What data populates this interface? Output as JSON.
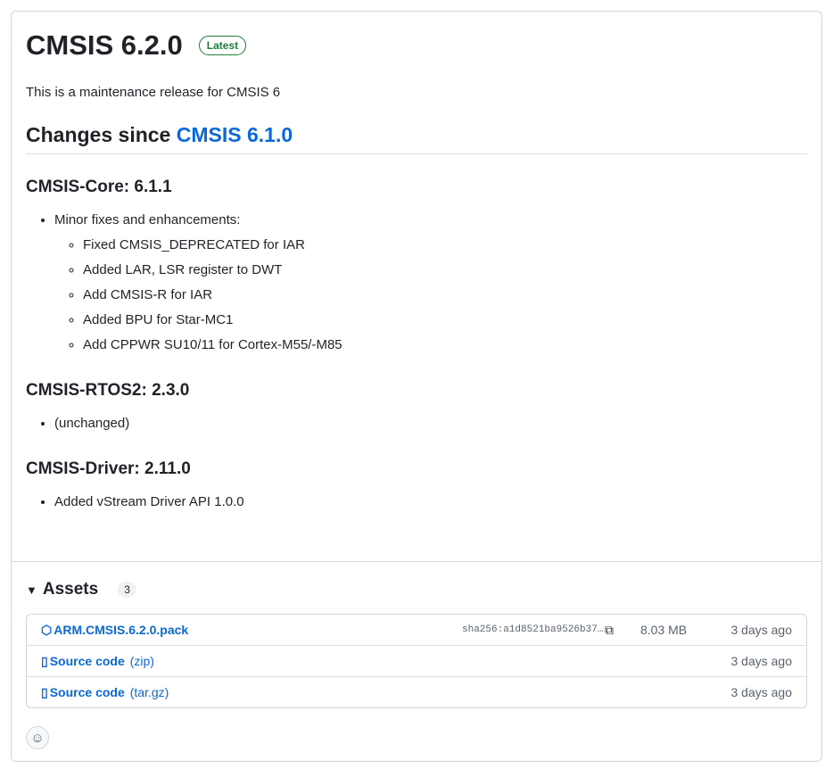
{
  "release": {
    "title": "CMSIS 6.2.0",
    "badge": "Latest",
    "intro": "This is a maintenance release for CMSIS 6",
    "changes_prefix": "Changes since ",
    "changes_link": "CMSIS 6.1.0",
    "sections": [
      {
        "heading": "CMSIS-Core: 6.1.1",
        "item": "Minor fixes and enhancements:",
        "subitems": [
          "Fixed CMSIS_DEPRECATED for IAR",
          "Added LAR, LSR register to DWT",
          "Add CMSIS-R for IAR",
          "Added BPU for Star-MC1",
          "Add CPPWR SU10/11 for Cortex-M55/-M85"
        ]
      },
      {
        "heading": "CMSIS-RTOS2: 2.3.0",
        "item": "(unchanged)"
      },
      {
        "heading": "CMSIS-Driver: 2.11.0",
        "item": "Added vStream Driver API 1.0.0"
      }
    ]
  },
  "assets": {
    "label": "Assets",
    "count": "3",
    "rows": [
      {
        "name": "ARM.CMSIS.6.2.0.pack",
        "sha": "sha256:a1d8521ba9526b37…",
        "size": "8.03 MB",
        "date": "3 days ago"
      },
      {
        "name": "Source code",
        "ext": "(zip)",
        "date": "3 days ago"
      },
      {
        "name": "Source code",
        "ext": "(tar.gz)",
        "date": "3 days ago"
      }
    ]
  }
}
